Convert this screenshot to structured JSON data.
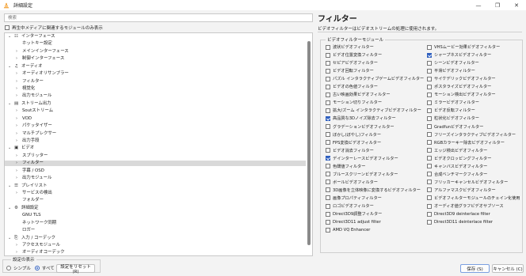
{
  "window": {
    "title": "詳細設定",
    "controls": [
      "—",
      "❐",
      "✕"
    ]
  },
  "search": {
    "placeholder": "検索"
  },
  "only_current_media": {
    "label": "再生中メディアに関連するモジュールのみ表示",
    "checked": false
  },
  "tree": [
    {
      "label": "インターフェース",
      "level": 0,
      "expanded": true,
      "icon": "sliders-icon",
      "selected": false
    },
    {
      "label": "ホットキー設定",
      "level": 1,
      "expanded": null,
      "selected": false
    },
    {
      "label": "メインインターフェース",
      "level": 1,
      "expanded": false,
      "selected": false
    },
    {
      "label": "制御インターフェース",
      "level": 1,
      "expanded": false,
      "selected": false
    },
    {
      "label": "オーディオ",
      "level": 0,
      "expanded": true,
      "icon": "music-note-icon",
      "selected": false
    },
    {
      "label": "オーディオリサンプラー",
      "level": 1,
      "expanded": false,
      "selected": false
    },
    {
      "label": "フィルター",
      "level": 1,
      "expanded": false,
      "selected": false
    },
    {
      "label": "視覚化",
      "level": 1,
      "expanded": false,
      "selected": false
    },
    {
      "label": "出力モジュール",
      "level": 1,
      "expanded": false,
      "selected": false
    },
    {
      "label": "ストリーム出力",
      "level": 0,
      "expanded": true,
      "icon": "stream-icon",
      "selected": false
    },
    {
      "label": "Soutストリーム",
      "level": 1,
      "expanded": false,
      "selected": false
    },
    {
      "label": "VOD",
      "level": 1,
      "expanded": false,
      "selected": false
    },
    {
      "label": "パケッタイザー",
      "level": 1,
      "expanded": false,
      "selected": false
    },
    {
      "label": "マルチプレクサー",
      "level": 1,
      "expanded": false,
      "selected": false
    },
    {
      "label": "出力手段",
      "level": 1,
      "expanded": false,
      "selected": false
    },
    {
      "label": "ビデオ",
      "level": 0,
      "expanded": true,
      "icon": "video-icon",
      "selected": false
    },
    {
      "label": "スプリッター",
      "level": 1,
      "expanded": false,
      "selected": false
    },
    {
      "label": "フィルター",
      "level": 1,
      "expanded": false,
      "selected": true
    },
    {
      "label": "字幕 / OSD",
      "level": 1,
      "expanded": false,
      "selected": false
    },
    {
      "label": "出力モジュール",
      "level": 1,
      "expanded": false,
      "selected": false
    },
    {
      "label": "プレイリスト",
      "level": 0,
      "expanded": true,
      "icon": "playlist-icon",
      "selected": false
    },
    {
      "label": "サービスの検出",
      "level": 1,
      "expanded": false,
      "selected": false
    },
    {
      "label": "フォルダー",
      "level": 1,
      "expanded": null,
      "selected": false
    },
    {
      "label": "詳細設定",
      "level": 0,
      "expanded": true,
      "icon": "gear-icon",
      "selected": false
    },
    {
      "label": "GNU TLS",
      "level": 1,
      "expanded": null,
      "selected": false
    },
    {
      "label": "ネットワーク同期",
      "level": 1,
      "expanded": null,
      "selected": false
    },
    {
      "label": "ロガー",
      "level": 1,
      "expanded": null,
      "selected": false
    },
    {
      "label": "入力 / コーデック",
      "level": 0,
      "expanded": true,
      "icon": "input-icon",
      "selected": false
    },
    {
      "label": "アクセスモジュール",
      "level": 1,
      "expanded": false,
      "selected": false
    },
    {
      "label": "オーディオコーデック",
      "level": 1,
      "expanded": false,
      "selected": false
    }
  ],
  "display": {
    "legend": "設定の表示",
    "simple_label": "シンプル",
    "all_label": "すべて",
    "selected": "all"
  },
  "reset_button": "設定をリセット (R)",
  "save_button": "保存 (S)",
  "cancel_button": "キャンセル (C)",
  "panel": {
    "title": "フィルター",
    "description": "ビデオフィルターはビデオストリームの処理に使用されます。",
    "group_legend": "ビデオフィルターモジュール",
    "modules_left": [
      {
        "label": "波状ビデオフィルター",
        "checked": false
      },
      {
        "label": "ビデオ位置変換フィルター",
        "checked": false
      },
      {
        "label": "セピアビデオフィルター",
        "checked": false
      },
      {
        "label": "ビデオ回転フィルター",
        "checked": false
      },
      {
        "label": "パズル インタラクティブゲームビデオフィルター",
        "checked": false
      },
      {
        "label": "ビデオの色値フィルター",
        "checked": false
      },
      {
        "label": "古い映画効果ビデオフィルター",
        "checked": false
      },
      {
        "label": "モーション切りフィルター",
        "checked": false
      },
      {
        "label": "拡大/ズーム インタラクティブビデオフィルター",
        "checked": false
      },
      {
        "label": "高品質な3Dノイズ除去フィルター",
        "checked": true
      },
      {
        "label": "グラデーションビデオフィルター",
        "checked": false
      },
      {
        "label": "ぼかし(ぼやし)フィルター",
        "checked": false
      },
      {
        "label": "FPS変換ビデオフィルター",
        "checked": false
      },
      {
        "label": "ビデオ消去フィルター",
        "checked": false
      },
      {
        "label": "デインターレースビデオフィルター",
        "checked": true
      },
      {
        "label": "色閾値フィルター",
        "checked": false
      },
      {
        "label": "ブルースクリーンビデオフィルター",
        "checked": false
      },
      {
        "label": "ボールビデオフィルター",
        "checked": false
      },
      {
        "label": "3D画像を立体映像に変換するビデオフィルター",
        "checked": false
      },
      {
        "label": "画像プロパティフィルター",
        "checked": false
      },
      {
        "label": "ロゴビデオフィルター",
        "checked": false
      },
      {
        "label": "Direct3D9調整フィルター",
        "checked": false
      },
      {
        "label": "Direct3D11 adjust filter",
        "checked": false
      },
      {
        "label": "AMD VQ Enhancer",
        "checked": false
      }
    ],
    "modules_right": [
      {
        "label": "VHSムービー効果ビデオフィルター",
        "checked": false
      },
      {
        "label": "シャープネスビデオフィルター",
        "checked": true
      },
      {
        "label": "シーンビデオフィルター",
        "checked": false
      },
      {
        "label": "平滑ビデオフィルター",
        "checked": false
      },
      {
        "label": "サイケデリックビデオフィルター",
        "checked": false
      },
      {
        "label": "ポスタライズビデオフィルター",
        "checked": false
      },
      {
        "label": "モーション検出ビデオフィルター",
        "checked": false
      },
      {
        "label": "ミラービデオフィルター",
        "checked": false
      },
      {
        "label": "ビデオ反転フィルター",
        "checked": false
      },
      {
        "label": "粒状化ビデオフィルター",
        "checked": false
      },
      {
        "label": "Gradfunビデオフィルター",
        "checked": false
      },
      {
        "label": "フリーズインタラクティブビデオフィルター",
        "checked": false
      },
      {
        "label": "RGBカラーキー除去ビデオフィルター",
        "checked": false
      },
      {
        "label": "エッジ検出ビデオフィルター",
        "checked": false
      },
      {
        "label": "ビデオクロッピングフィルター",
        "checked": false
      },
      {
        "label": "キャンバスビデオフィルター",
        "checked": false
      },
      {
        "label": "合成ベンチマークフィルター",
        "checked": false
      },
      {
        "label": "フリッカーキャンセルビデオフィルター",
        "checked": false
      },
      {
        "label": "アルファマスクビデオフィルター",
        "checked": false
      },
      {
        "label": "ビデオフィルターモジュールのチェイン化使用",
        "checked": false
      },
      {
        "label": "オーディオ値グラフビデオサブソース",
        "checked": false
      },
      {
        "label": "Direct3D9 deinterlace filter",
        "checked": false
      },
      {
        "label": "Direct3D11 deinterlace filter",
        "checked": false
      }
    ]
  },
  "colors": {
    "accent": "#2f5fbf",
    "selected_row": "#d9d9d9"
  }
}
